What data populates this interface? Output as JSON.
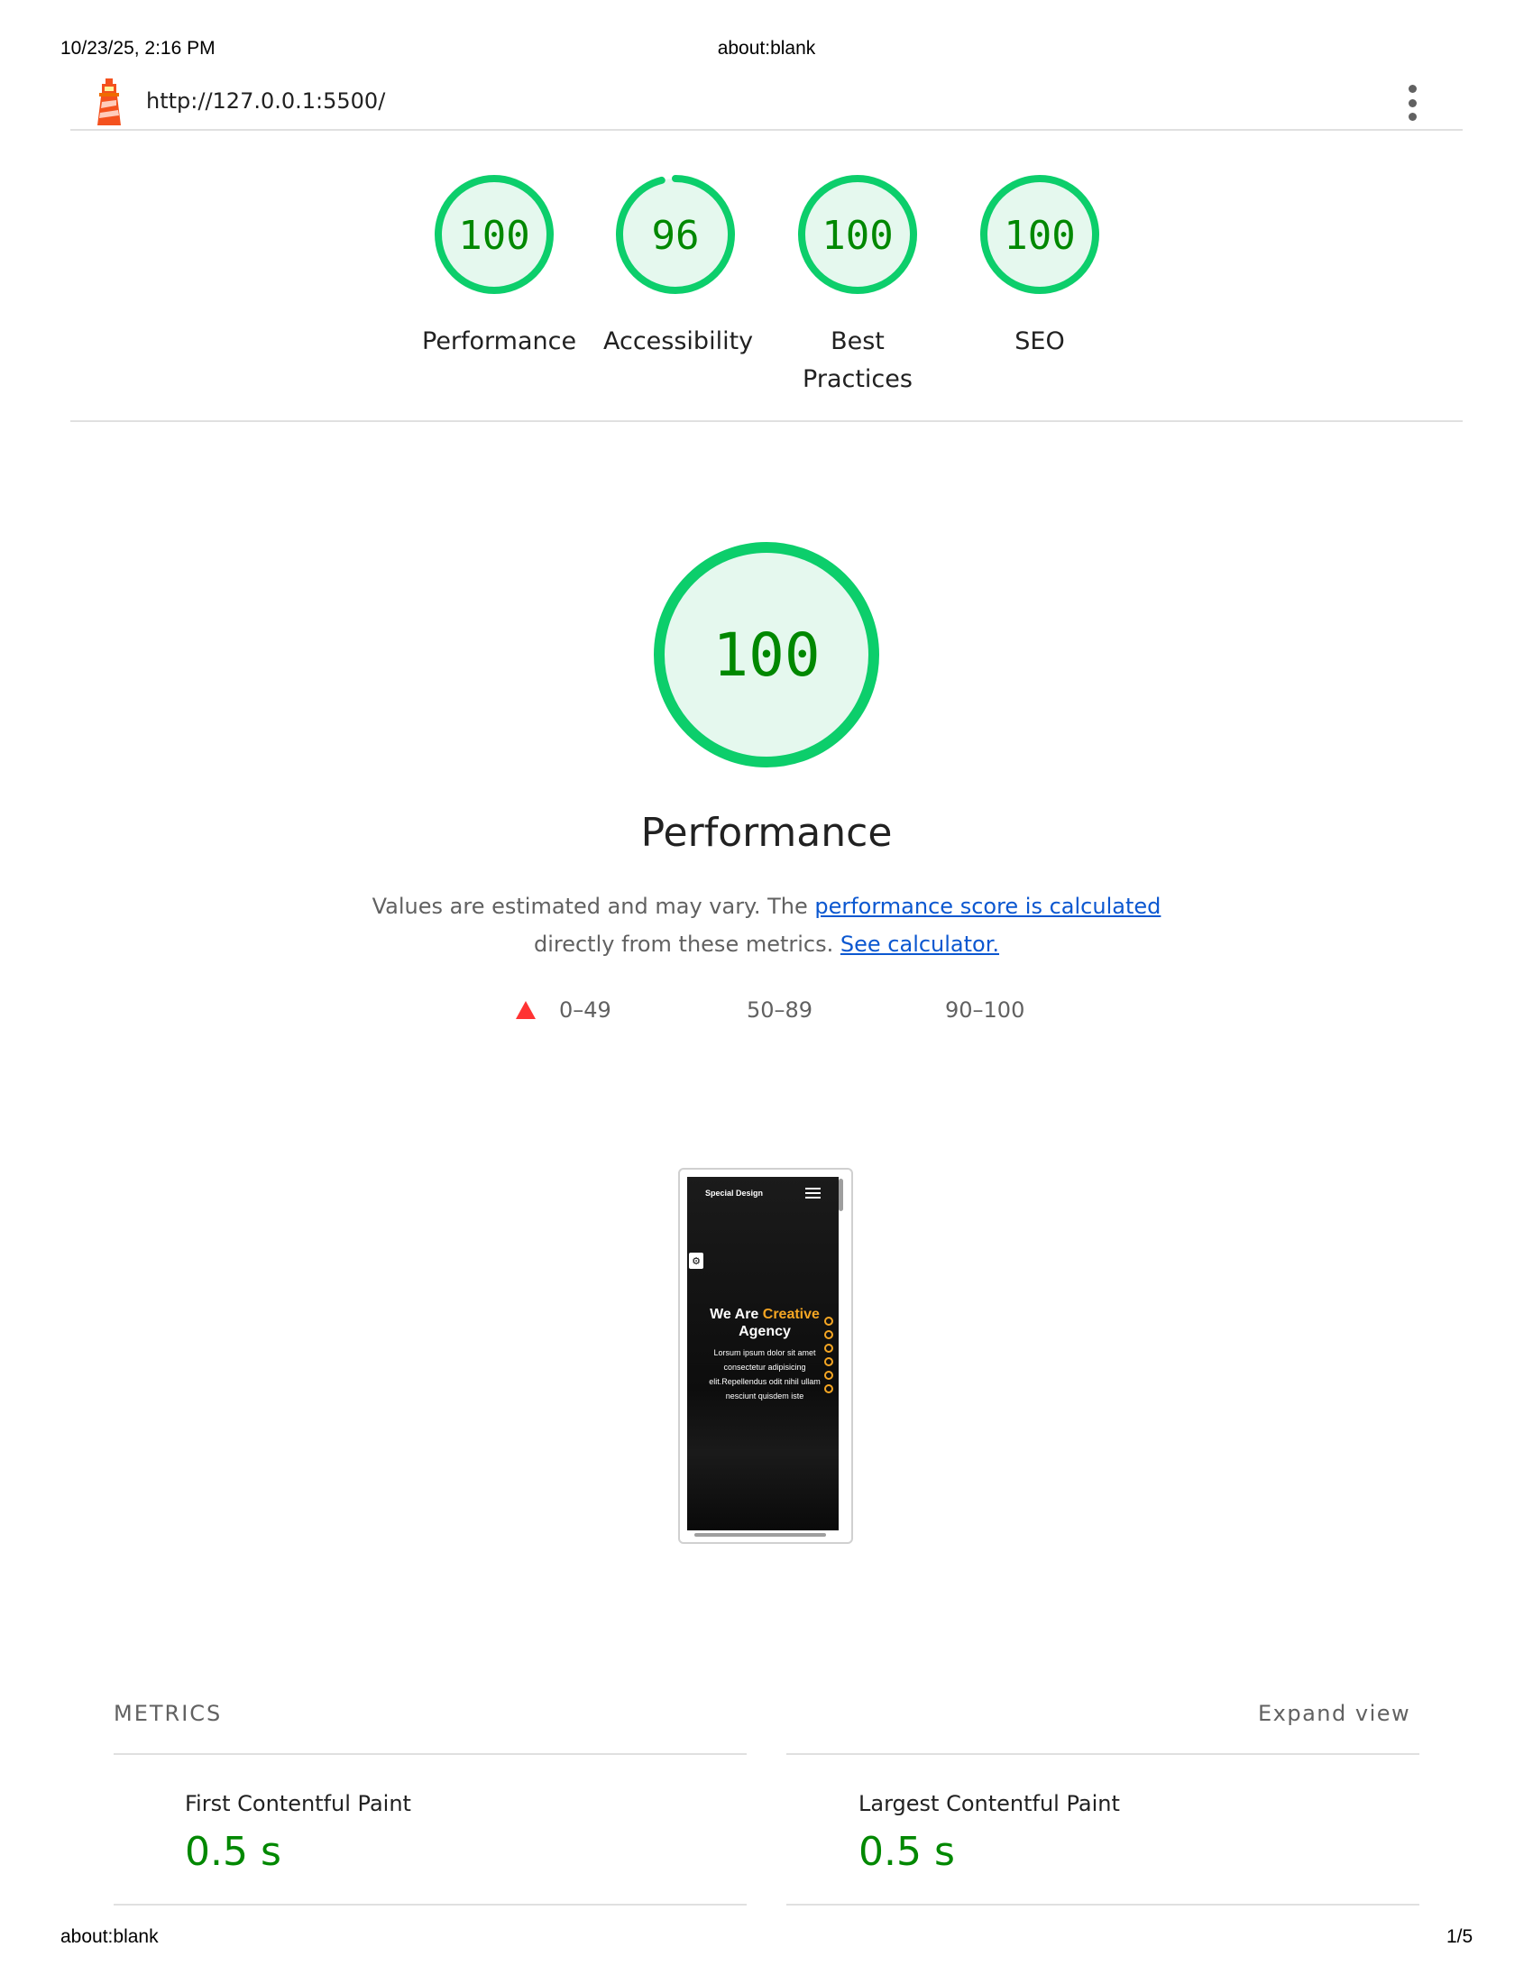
{
  "print_header": {
    "datetime": "10/23/25, 2:16 PM",
    "page_title": "about:blank"
  },
  "print_footer": {
    "url": "about:blank",
    "page": "1/5"
  },
  "topbar": {
    "url": "http://127.0.0.1:5500/",
    "logo_icon": "lighthouse-icon",
    "menu_icon": "kebab-menu-icon"
  },
  "gauges": [
    {
      "score": "100",
      "label": "Performance",
      "fraction": 1.0
    },
    {
      "score": "96",
      "label": "Accessibility",
      "fraction": 0.96
    },
    {
      "score": "100",
      "label_line1": "Best",
      "label_line2": "Practices",
      "fraction": 1.0
    },
    {
      "score": "100",
      "label": "SEO",
      "fraction": 1.0
    }
  ],
  "performance": {
    "score": "100",
    "title": "Performance",
    "desc_prefix": "Values are estimated and may vary. The ",
    "desc_link1": "performance score is calculated",
    "desc_middle": " directly from these metrics.",
    "desc_link2": "See calculator.",
    "legend": [
      {
        "range": "0–49",
        "icon": "red-triangle-icon"
      },
      {
        "range": "50–89"
      },
      {
        "range": "90–100"
      }
    ]
  },
  "screenshot": {
    "brand": "Special Design",
    "hero_title_prefix": "We Are ",
    "hero_title_accent": "Creative",
    "hero_title_suffix": "Agency",
    "hero_text": "Lorsum ipsum dolor sit amet consectetur adipisicing elit.Repellendus odit nihil ullam nesciunt quisdem iste"
  },
  "metrics": {
    "title": "METRICS",
    "expand_label": "Expand view",
    "items": [
      {
        "label": "First Contentful Paint",
        "value": "0.5 s"
      },
      {
        "label": "Largest Contentful Paint",
        "value": "0.5 s"
      }
    ]
  },
  "colors": {
    "pass": "#0cce6b",
    "pass_text": "#008800",
    "pass_bg": "#e5f8ee",
    "fail": "#ff3333",
    "link": "#0b57d0"
  }
}
